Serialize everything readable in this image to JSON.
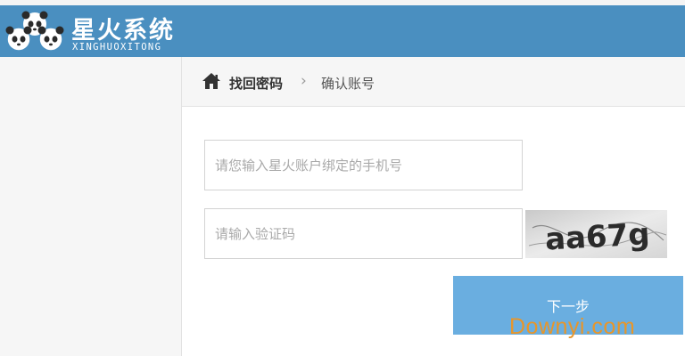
{
  "header": {
    "logo_title": "星火系统",
    "logo_subtitle": "XINGHUOXITONG",
    "background_color": "#4a8fc0"
  },
  "breadcrumb": {
    "home_icon": "home-icon",
    "current": "找回密码",
    "separator": "›",
    "next": "确认账号"
  },
  "form": {
    "phone_placeholder": "请您输入星火账户绑定的手机号",
    "phone_value": "",
    "code_placeholder": "请输入验证码",
    "code_value": "",
    "captcha_text": "aa67g",
    "next_label": "下一步",
    "button_color": "#6aaee0"
  },
  "watermark": "Downyi.com"
}
